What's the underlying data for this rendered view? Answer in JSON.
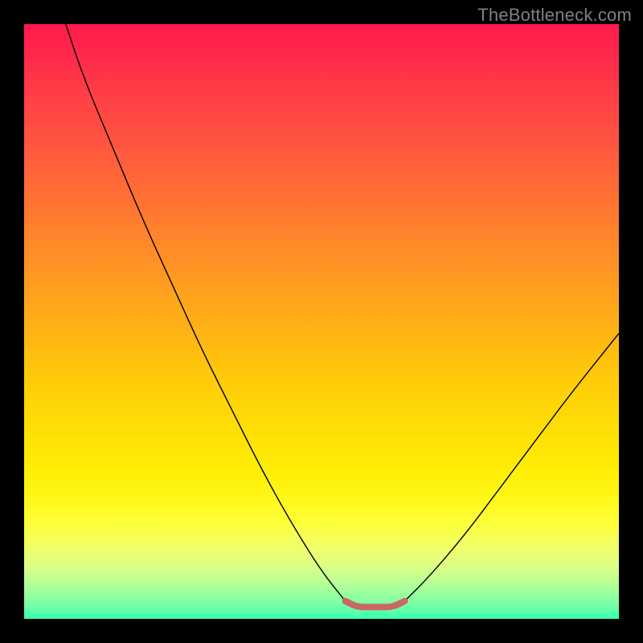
{
  "watermark": "TheBottleneck.com",
  "chart_data": {
    "type": "line",
    "title": "",
    "xlabel": "",
    "ylabel": "",
    "xlim": [
      0,
      100
    ],
    "ylim": [
      0,
      100
    ],
    "grid": false,
    "gradient": {
      "direction": "top-to-bottom",
      "stops": [
        {
          "pct": 0,
          "color": "#ff1a4d"
        },
        {
          "pct": 25,
          "color": "#ff7a2e"
        },
        {
          "pct": 55,
          "color": "#ffd40a"
        },
        {
          "pct": 80,
          "color": "#fff81a"
        },
        {
          "pct": 100,
          "color": "#32ffb0"
        }
      ]
    },
    "series": [
      {
        "name": "left-curve",
        "x": [
          7,
          10,
          15,
          20,
          25,
          30,
          35,
          40,
          45,
          50,
          54
        ],
        "values": [
          100,
          91,
          79,
          67,
          56,
          45,
          35,
          25,
          16,
          8,
          3
        ]
      },
      {
        "name": "right-curve",
        "x": [
          64,
          68,
          74,
          80,
          86,
          92,
          100
        ],
        "values": [
          3,
          7,
          14,
          22,
          30,
          38,
          48
        ]
      },
      {
        "name": "optimal-flat",
        "x": [
          54,
          56,
          58,
          60,
          62,
          64
        ],
        "values": [
          3,
          2,
          2,
          2,
          2,
          3
        ]
      }
    ],
    "annotations": []
  }
}
